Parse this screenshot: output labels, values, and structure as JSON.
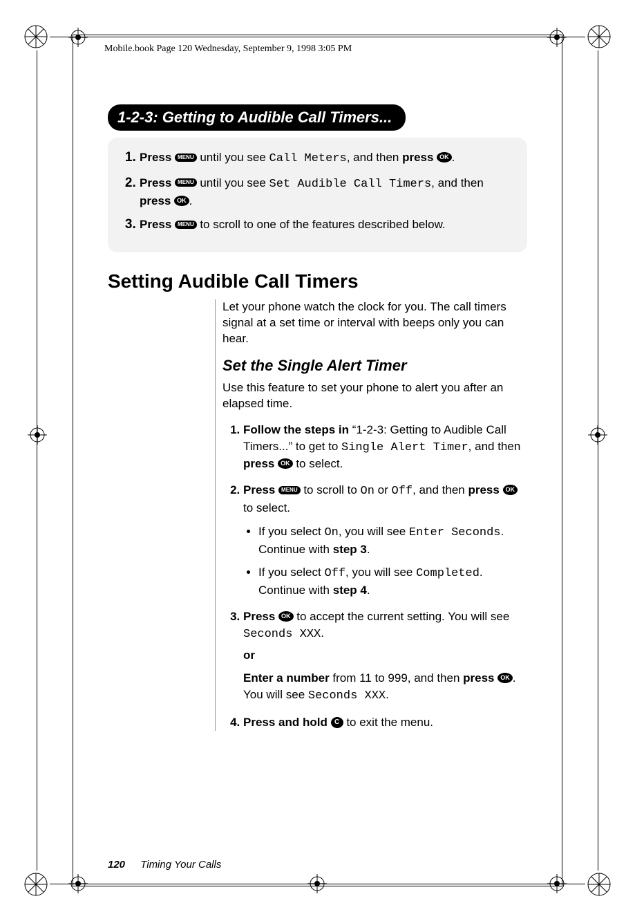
{
  "header": "Mobile.book  Page 120  Wednesday, September 9, 1998  3:05 PM",
  "pill": {
    "num": "1-2-3:",
    "title": " Getting to Audible Call Timers..."
  },
  "buttons": {
    "menu": "MENU",
    "ok": "OK",
    "c": "C"
  },
  "box123": {
    "s1a": "Press ",
    "s1b": " until you see ",
    "s1lcd": "Call Meters",
    "s1c": ", and then ",
    "s1d": "press ",
    "s1e": ".",
    "s2a": "Press ",
    "s2b": " until you see ",
    "s2lcd": "Set Audible Call Timers",
    "s2c": ", and then ",
    "s2d": "press ",
    "s2e": ".",
    "s3a": "Press ",
    "s3b": " to scroll to one of the features described below."
  },
  "section": "Setting Audible Call Timers",
  "intro": "Let your phone watch the clock for you. The call timers signal at a set time or interval with beeps only you can hear.",
  "sub": "Set the Single Alert Timer",
  "subintro": "Use this feature to set your phone to alert you after an elapsed time.",
  "steps": {
    "s1a": "Follow the steps in ",
    "s1b": "“1-2-3: Getting to Audible Call Timers...” to get to ",
    "s1lcd": "Single Alert Timer",
    "s1c": ", and then ",
    "s1d": "press ",
    "s1e": " to select.",
    "s2a": "Press ",
    "s2b": " to scroll to ",
    "s2on": "On",
    "s2or": " or ",
    "s2off": "Off",
    "s2c": ", and then ",
    "s2d": "press ",
    "s2e": " to select.",
    "b1a": "If you select ",
    "b1on": "On",
    "b1b": ", you will see ",
    "b1lcd": "Enter Seconds",
    "b1c": ". Continue with ",
    "b1d": "step 3",
    "b1e": ".",
    "b2a": "If you select ",
    "b2off": "Off",
    "b2b": ", you will see ",
    "b2lcd": "Completed",
    "b2c": ". Continue with ",
    "b2d": "step 4",
    "b2e": ".",
    "s3a": "Press ",
    "s3b": " to accept the current setting. You will see ",
    "s3lcd": "Seconds XXX",
    "s3c": ".",
    "or": "or",
    "s3alt_a": "Enter a number",
    "s3alt_b": " from 11 to 999, and then ",
    "s3alt_c": "press ",
    "s3alt_d": ". You will see ",
    "s3alt_lcd": "Seconds XXX",
    "s3alt_e": ".",
    "s4a": "Press and hold ",
    "s4b": " to exit the menu."
  },
  "footer": {
    "page": "120",
    "chapter": "Timing Your Calls"
  }
}
